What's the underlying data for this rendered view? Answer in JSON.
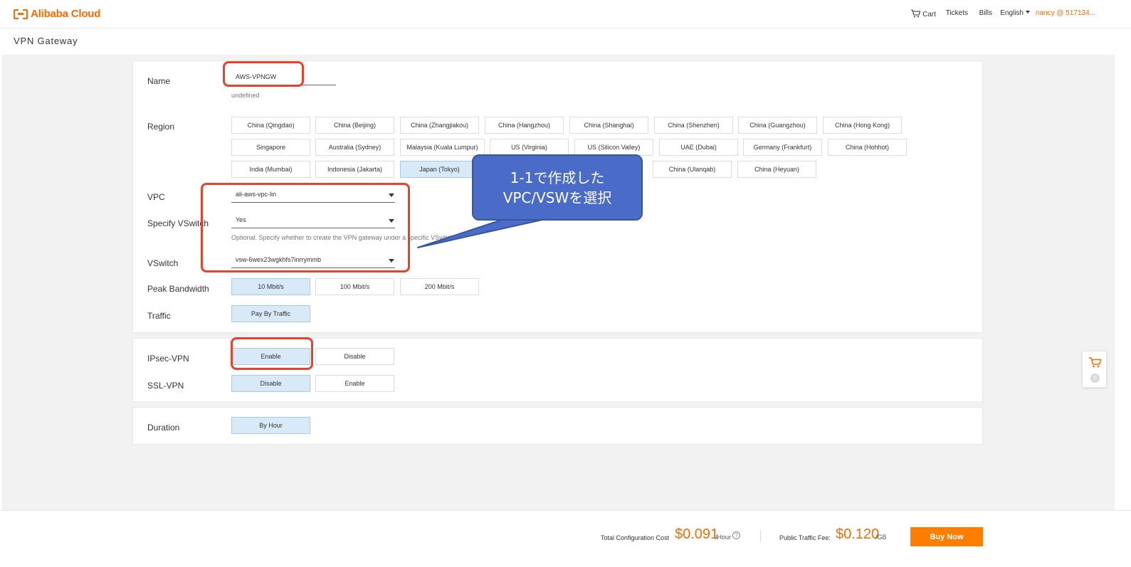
{
  "header": {
    "logo_text": "Alibaba Cloud",
    "cart": "Cart",
    "tickets": "Tickets",
    "bills": "Bills",
    "language": "English",
    "user": "nancy @ 517134..."
  },
  "page_title": "VPN Gateway",
  "form": {
    "name": {
      "label": "Name",
      "value": "AWS-VPNGW",
      "hint": "undefined"
    },
    "region": {
      "label": "Region",
      "selected": "Japan (Tokyo)",
      "options": [
        "China (Qingdao)",
        "China (Beijing)",
        "China (Zhangjiakou)",
        "China (Hangzhou)",
        "China (Shanghai)",
        "China (Shenzhen)",
        "China (Guangzhou)",
        "China (Hong Kong)",
        "Singapore",
        "Australia (Sydney)",
        "Malaysia (Kuala Lumpur)",
        "US (Virginia)",
        "US (Silicon Valley)",
        "UAE (Dubai)",
        "Germany (Frankfurt)",
        "China (Hohhot)",
        "India (Mumbai)",
        "Indonesia (Jakarta)",
        "Japan (Tokyo)",
        "China (Ulanqab)",
        "China (Heyuan)"
      ]
    },
    "vpc": {
      "label": "VPC",
      "value": "ali-aws-vpc-lin"
    },
    "specify_vswitch": {
      "label": "Specify VSwitch",
      "value": "Yes",
      "hint": "Optional. Specify whether to create the VPN gateway under a specific VSwitch"
    },
    "vswitch": {
      "label": "VSwitch",
      "value": "vsw-6wex23wgkhfs7inrrymmb"
    },
    "peak_bandwidth": {
      "label": "Peak Bandwidth",
      "options": [
        "10 Mbit/s",
        "100 Mbit/s",
        "200 Mbit/s"
      ],
      "selected": "10 Mbit/s"
    },
    "traffic": {
      "label": "Traffic",
      "options": [
        "Pay By Traffic"
      ],
      "selected": "Pay By Traffic"
    },
    "ipsec_vpn": {
      "label": "IPsec-VPN",
      "options": [
        "Enable",
        "Disable"
      ],
      "selected": "Enable"
    },
    "ssl_vpn": {
      "label": "SSL-VPN",
      "options": [
        "Disable",
        "Enable"
      ],
      "selected": "Disable"
    },
    "duration": {
      "label": "Duration",
      "options": [
        "By Hour"
      ],
      "selected": "By Hour"
    }
  },
  "callout": {
    "line1": "1-1で作成した",
    "line2": "VPC/VSWを選択"
  },
  "float_cart": {
    "count": "0"
  },
  "footer": {
    "total_label": "Total Configuration Cost",
    "total_price": "$0.091",
    "total_unit": "/Hour",
    "traffic_label": "Public Traffic Fee:",
    "traffic_price": "$0.120",
    "traffic_unit": "/GB",
    "buy_label": "Buy Now"
  },
  "colors": {
    "accent": "#ff6a00",
    "selected_bg": "#d8e9f7",
    "highlight": "#e8422b",
    "callout": "#4a6bc7"
  }
}
